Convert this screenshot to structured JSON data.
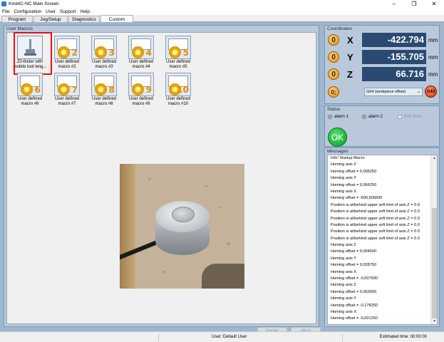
{
  "window": {
    "title": "KinetiC-NC Main Screen",
    "controls": [
      "–",
      "❐",
      "✕"
    ]
  },
  "menu": [
    "File",
    "Configuration",
    "User",
    "Support",
    "Help"
  ],
  "tabs": [
    "Program",
    "Jog/Setup",
    "Diagnostics",
    "Custom"
  ],
  "macros": {
    "title": "User Macros",
    "items": [
      {
        "label": "Z0-finder with mobile tool leng...",
        "num": ""
      },
      {
        "label": "User defined macro #2",
        "num": "2"
      },
      {
        "label": "User defined macro #3",
        "num": "3"
      },
      {
        "label": "User defined macro #4",
        "num": "4"
      },
      {
        "label": "User defined macro #5",
        "num": "5"
      },
      {
        "label": "User defined macro #6",
        "num": "6"
      },
      {
        "label": "User defined macro #7",
        "num": "7"
      },
      {
        "label": "User defined macro #8",
        "num": "8"
      },
      {
        "label": "User defined macro #9",
        "num": "9"
      },
      {
        "label": "User defined macro #10",
        "num": "10"
      }
    ],
    "invoke_label": "Invoke",
    "abort_label": "Abort"
  },
  "coordinates": {
    "title": "Coordinates",
    "axes": [
      {
        "zero": "0",
        "axis": "X",
        "value": "-422.794",
        "unit": "mm"
      },
      {
        "zero": "0",
        "axis": "Y",
        "value": "-155.705",
        "unit": "mm"
      },
      {
        "zero": "0",
        "axis": "Z",
        "value": "66.716",
        "unit": "mm"
      }
    ],
    "wcs_zero": "0;",
    "wcs_selected": "G54 (workpiece offset)",
    "g43_label": "G43"
  },
  "status": {
    "title": "Status",
    "alarm1": "alarm 1",
    "alarm2": "alarm 2",
    "soft_limits": "Soft limits",
    "ok_label": "OK"
  },
  "messages": {
    "title": "Messages",
    "lines": [
      "Info! Startup Macro",
      "Homing axis Z",
      "Homing offset = 0,006250",
      "Homing axis Y",
      "Homing offset = 0,066250",
      "Homing axis X",
      "Homing offset = -600,505000",
      "Position is at/behind upper soft limit of axis Z = 0.0",
      "Position is at/behind upper soft limit of axis Z = 0.0",
      "Position is at/behind upper soft limit of axis Z = 0.0",
      "Position is at/behind upper soft limit of axis Z = 0.0",
      "Position is at/behind upper soft limit of axis Z = 0.0",
      "Position is at/behind upper soft limit of axis Z = 0.0",
      "Homing axis Z",
      "Homing offset = 0,004500",
      "Homing axis Y",
      "Homing offset = 0,028750",
      "Homing axis X",
      "Homing offset = -0,007500",
      "Homing axis Z",
      "Homing offset = 0,003000",
      "Homing axis Y",
      "Homing offset = -0,178250",
      "Homing axis X",
      "Homing offset = -0,001250"
    ]
  },
  "statusbar": {
    "user": "User: Default User",
    "time": "Estimated time: 00:00:00"
  },
  "colors": {
    "readout_bg": "#2a4a72",
    "panel_bg": "#b9c9db",
    "ok_green": "#0f9a2c",
    "highlight": "#e01018"
  }
}
